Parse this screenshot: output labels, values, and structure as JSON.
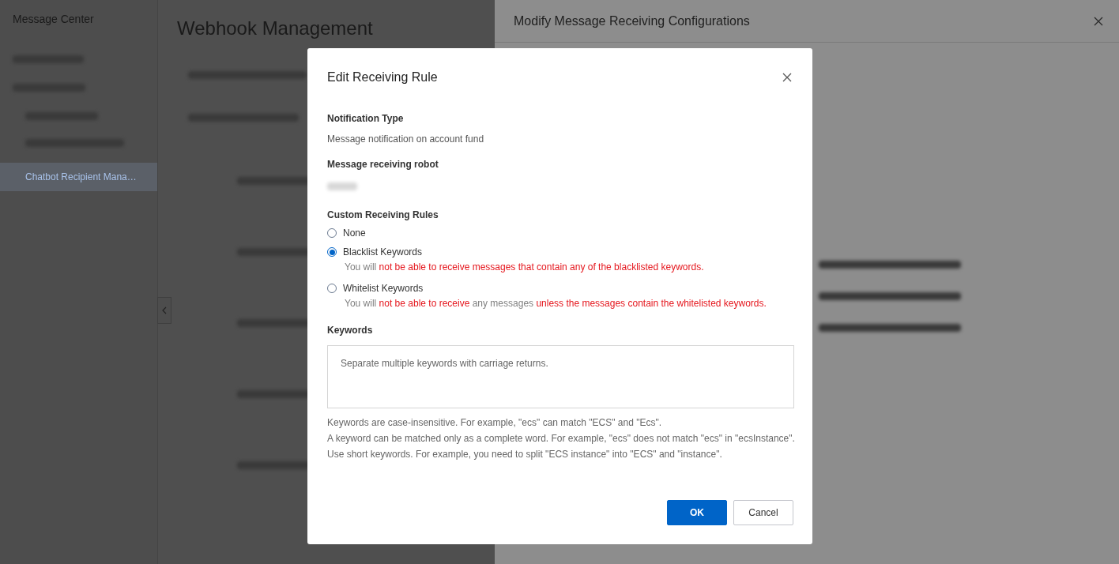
{
  "sidebar": {
    "title": "Message Center",
    "items": [
      {
        "label": "Chatbot Recipient Mana…",
        "selected": true
      }
    ]
  },
  "page": {
    "title": "Webhook Management"
  },
  "drawer": {
    "title": "Modify Message Receiving Configurations"
  },
  "dialog": {
    "title": "Edit Receiving Rule",
    "fields": [
      {
        "label": "Notification Type",
        "value": "Message notification on account fund"
      },
      {
        "label": "Message receiving robot"
      }
    ],
    "rules_label": "Custom Receiving Rules",
    "rules": [
      {
        "label": "None",
        "selected": false
      },
      {
        "label": "Blacklist Keywords",
        "selected": true,
        "hint": [
          {
            "text": "You will ",
            "highlight": false
          },
          {
            "text": "not be able to receive messages that contain any of the blacklisted keywords.",
            "highlight": true
          }
        ]
      },
      {
        "label": "Whitelist Keywords",
        "selected": false,
        "hint": [
          {
            "text": "You will ",
            "highlight": false
          },
          {
            "text": "not be able to receive",
            "highlight": true
          },
          {
            "text": " any messages ",
            "highlight": false
          },
          {
            "text": "unless the messages contain the whitelisted keywords.",
            "highlight": true
          }
        ]
      }
    ],
    "keywords": {
      "label": "Keywords",
      "placeholder": "Separate multiple keywords with carriage returns."
    },
    "notes": [
      "Keywords are case-insensitive. For example, \"ecs\" can match \"ECS\" and \"Ecs\".",
      "A keyword can be matched only as a complete word. For example, \"ecs\" does not match \"ecs\" in \"ecsInstance\".",
      "Use short keywords. For example, you need to split \"ECS instance\" into \"ECS\" and \"instance\"."
    ],
    "buttons": [
      {
        "label": "OK",
        "kind": "primary"
      },
      {
        "label": "Cancel",
        "kind": "secondary"
      }
    ]
  }
}
